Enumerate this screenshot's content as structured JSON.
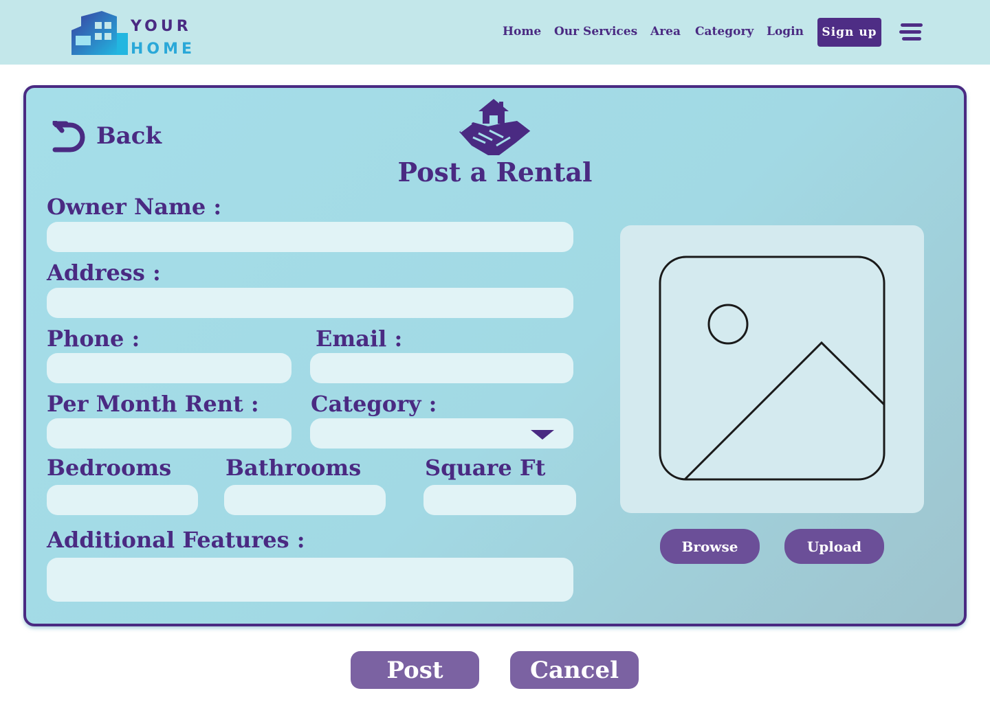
{
  "header": {
    "logo": {
      "line1": "YOUR",
      "line2": "HOME"
    },
    "nav": [
      "Home",
      "Our Services",
      "Area",
      "Category",
      "Login"
    ],
    "signup_label": "Sign up",
    "menu_icon": "hamburger-icon"
  },
  "form": {
    "back_label": "Back",
    "title": "Post a Rental",
    "title_icon": "handshake-house-icon",
    "labels": {
      "owner_name": "Owner Name :",
      "address": "Address :",
      "phone": "Phone :",
      "email": "Email :",
      "rent": "Per Month Rent :",
      "category": "Category :",
      "bedrooms": "Bedrooms",
      "bathrooms": "Bathrooms",
      "square_ft": "Square Ft",
      "features": "Additional Features :"
    },
    "values": {
      "owner_name": "",
      "address": "",
      "phone": "",
      "email": "",
      "rent": "",
      "category": "",
      "bedrooms": "",
      "bathrooms": "",
      "square_ft": "",
      "features": ""
    }
  },
  "image_upload": {
    "placeholder_icon": "image-placeholder-icon",
    "browse_label": "Browse",
    "upload_label": "Upload"
  },
  "actions": {
    "post_label": "Post",
    "cancel_label": "Cancel"
  },
  "colors": {
    "header_bg": "#c3e7ea",
    "primary_purple": "#4a2a82",
    "button_purple": "#6b4f98",
    "field_bg": "#e1f3f6"
  }
}
